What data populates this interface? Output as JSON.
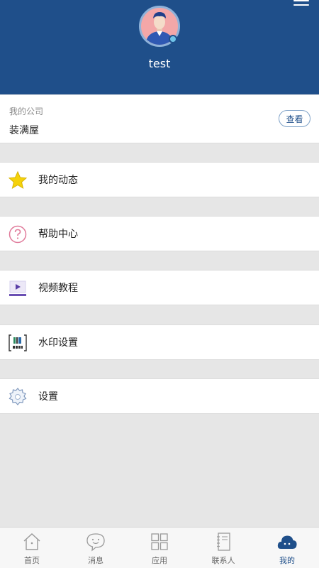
{
  "profile": {
    "username": "test"
  },
  "company": {
    "label": "我的公司",
    "name": "装满屋",
    "view_label": "查看"
  },
  "menu": [
    {
      "label": "我的动态",
      "icon": "star-icon"
    },
    {
      "label": "帮助中心",
      "icon": "question-icon"
    },
    {
      "label": "视频教程",
      "icon": "video-play-icon"
    },
    {
      "label": "水印设置",
      "icon": "watermark-icon"
    },
    {
      "label": "设置",
      "icon": "gear-icon"
    }
  ],
  "tabbar": [
    {
      "label": "首页",
      "icon": "home-icon"
    },
    {
      "label": "消息",
      "icon": "chat-icon"
    },
    {
      "label": "应用",
      "icon": "apps-grid-icon"
    },
    {
      "label": "联系人",
      "icon": "contacts-book-icon"
    },
    {
      "label": "我的",
      "icon": "cloud-user-icon",
      "active": true
    }
  ],
  "colors": {
    "header": "#1f4f8a",
    "accent": "#1f4f8a",
    "star": "#f5d20a",
    "question": "#e07a9a",
    "video": "#6a4fb3"
  }
}
